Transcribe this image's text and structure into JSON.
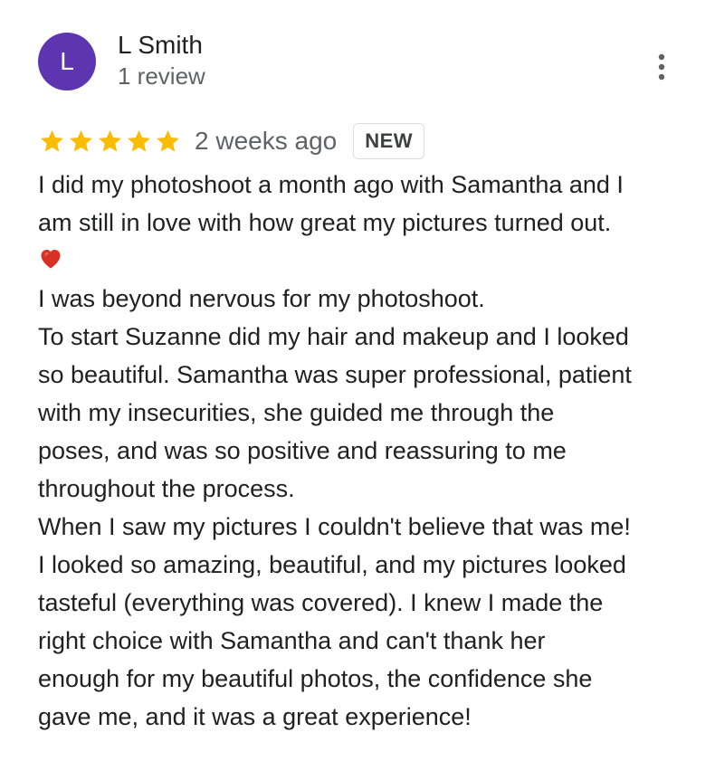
{
  "review": {
    "avatar_initial": "L",
    "user_name": "L Smith",
    "review_count": "1 review",
    "rating": 5,
    "time": "2 weeks ago",
    "badge": "NEW",
    "text_before_heart": "I did my photoshoot a month ago with Samantha and I\nam still in love with how great my pictures turned out.\n",
    "text_after_heart": "\nI was beyond nervous for my photoshoot.\nTo start Suzanne did my hair and makeup and I looked\nso beautiful. Samantha was super professional, patient\nwith my insecurities, she guided me through the\nposes, and was so positive and reassuring to me\nthroughout the process.\nWhen I saw my pictures I couldn't believe that was me!\nI looked so amazing, beautiful, and my pictures looked\ntasteful (everything was covered). I knew I made the\nright choice with Samantha and can't thank her\nenough for my beautiful photos, the confidence she\ngave me, and it was a great experience!"
  },
  "colors": {
    "avatar_background": "#5e35b1",
    "star": "#fbbc04",
    "heart": "#d93025",
    "secondary_text": "#5f6368"
  },
  "icons": {
    "more_options": "vertical-ellipsis-icon",
    "rating": "star-icon",
    "emoji": "red-heart-icon"
  }
}
